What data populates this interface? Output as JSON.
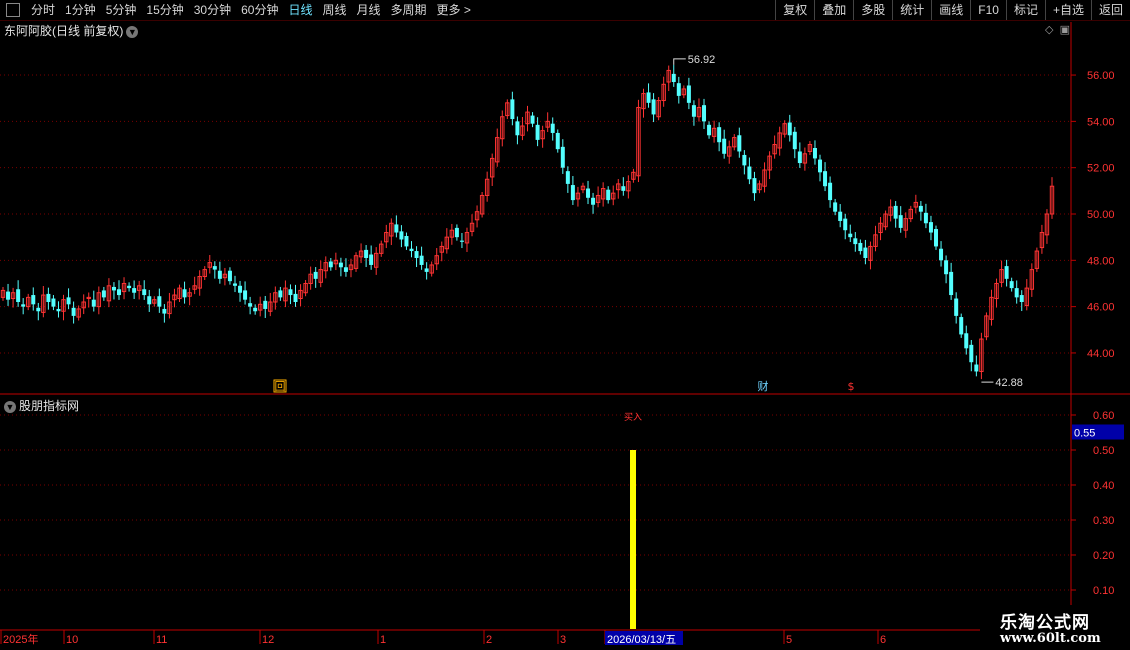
{
  "toolbar": {
    "periods": [
      "分时",
      "1分钟",
      "5分钟",
      "15分钟",
      "30分钟",
      "60分钟",
      "日线",
      "周线",
      "月线",
      "多周期",
      "更多 >"
    ],
    "active_period": "日线",
    "actions": [
      "复权",
      "叠加",
      "多股",
      "统计",
      "画线",
      "F10",
      "标记",
      "+自选",
      "返回"
    ]
  },
  "main_title": "东阿阿胶(日线 前复权)",
  "sub_title": "股朋指标网",
  "watermark": {
    "line1": "乐淘公式网",
    "line2": "www.60lt.com"
  },
  "colors": {
    "up": "#ff3333",
    "down": "#54ffff",
    "grid": "#7a0000",
    "axis": "#c00000",
    "signal_bar": "#ffff00",
    "current_value_bg": "#0000a8"
  },
  "chart_data": [
    {
      "type": "candlestick",
      "ylim": [
        42.4,
        57.6
      ],
      "y_ticks": [
        "44.00",
        "46.00",
        "48.00",
        "50.00",
        "52.00",
        "54.00",
        "56.00"
      ],
      "annotations": {
        "high": "56.92",
        "low": "42.88"
      },
      "event_markers": [
        "回",
        "财",
        "$"
      ],
      "close_series": [
        46.7,
        46.3,
        46.6,
        46.2,
        46.0,
        46.4,
        46.1,
        45.8,
        46.5,
        46.2,
        46.0,
        45.8,
        46.3,
        46.1,
        45.6,
        45.9,
        46.2,
        46.4,
        46.0,
        46.6,
        46.4,
        46.9,
        46.7,
        46.5,
        47.0,
        46.8,
        46.6,
        46.9,
        46.5,
        46.1,
        46.3,
        46.0,
        45.7,
        46.2,
        46.5,
        46.8,
        46.4,
        46.6,
        46.9,
        47.3,
        47.6,
        47.9,
        47.6,
        47.2,
        47.4,
        47.1,
        46.9,
        46.6,
        46.3,
        46.0,
        45.8,
        46.1,
        45.9,
        46.2,
        46.6,
        46.4,
        46.8,
        46.5,
        46.2,
        46.7,
        47.0,
        47.4,
        47.2,
        47.6,
        47.9,
        47.7,
        48.0,
        47.7,
        47.5,
        47.8,
        48.2,
        48.4,
        48.1,
        47.8,
        48.3,
        48.7,
        49.2,
        49.6,
        49.2,
        48.9,
        48.6,
        48.4,
        48.1,
        47.8,
        47.5,
        47.8,
        48.2,
        48.6,
        49.0,
        49.3,
        49.0,
        48.8,
        49.2,
        49.6,
        50.1,
        50.8,
        51.5,
        52.4,
        53.3,
        54.2,
        54.8,
        54.1,
        53.4,
        53.8,
        54.4,
        53.9,
        53.2,
        53.6,
        54.0,
        53.5,
        52.8,
        52.0,
        51.3,
        50.6,
        50.9,
        51.2,
        50.7,
        50.4,
        50.8,
        51.1,
        50.6,
        50.9,
        51.3,
        51.0,
        51.4,
        51.8,
        54.6,
        55.2,
        54.8,
        54.3,
        54.9,
        55.6,
        56.2,
        55.7,
        55.1,
        55.4,
        54.8,
        54.2,
        54.6,
        54.0,
        53.4,
        53.7,
        53.1,
        52.6,
        52.9,
        53.3,
        52.7,
        52.1,
        51.5,
        50.9,
        51.3,
        51.9,
        52.5,
        53.0,
        53.5,
        53.9,
        53.4,
        52.8,
        52.2,
        52.6,
        53.0,
        52.4,
        51.8,
        51.2,
        50.6,
        50.1,
        49.7,
        49.3,
        49.0,
        48.7,
        48.4,
        48.1,
        48.6,
        49.1,
        49.6,
        50.0,
        50.3,
        49.8,
        49.4,
        49.8,
        50.2,
        50.5,
        50.1,
        49.6,
        49.2,
        48.6,
        48.0,
        47.4,
        46.5,
        45.6,
        44.8,
        44.2,
        43.6,
        43.2,
        44.6,
        45.6,
        46.4,
        47.0,
        47.6,
        47.2,
        46.8,
        46.4,
        46.2,
        46.8,
        47.6,
        48.4,
        49.2,
        50.0,
        51.2
      ],
      "x_ticks": [
        "2025年",
        "10",
        "11",
        "12",
        "1",
        "2",
        "3",
        "2026/03/13/五",
        "5",
        "6"
      ]
    },
    {
      "type": "bar",
      "ylim": [
        0,
        0.6
      ],
      "y_ticks": [
        "0.10",
        "0.20",
        "0.30",
        "0.40",
        "0.50",
        "0.60"
      ],
      "current_value": "0.55",
      "signal_label": "买入",
      "signal_bar_value": 0.5
    }
  ]
}
